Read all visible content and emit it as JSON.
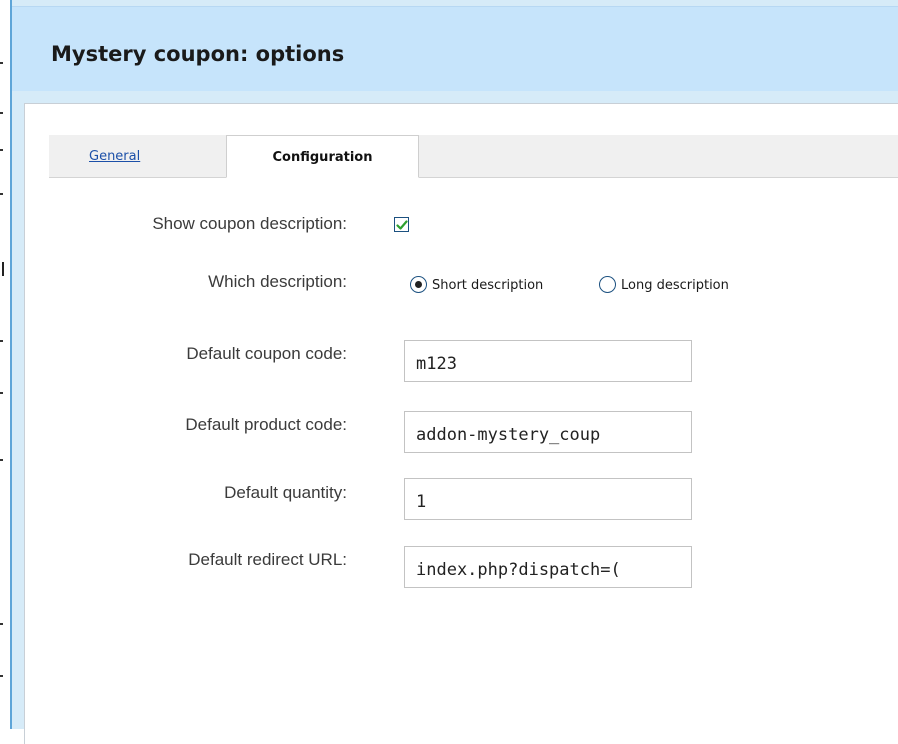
{
  "dialog": {
    "title": "Mystery coupon: options"
  },
  "tabs": [
    {
      "label": "General",
      "active": false
    },
    {
      "label": "Configuration",
      "active": true
    }
  ],
  "form": {
    "show_description": {
      "label": "Show coupon description:",
      "checked": true
    },
    "which_description": {
      "label": "Which description:",
      "options": [
        {
          "label": "Short description",
          "selected": true
        },
        {
          "label": "Long description",
          "selected": false
        }
      ]
    },
    "coupon_code": {
      "label": "Default coupon code:",
      "value": "m123"
    },
    "product_code": {
      "label": "Default product code:",
      "value": "addon-mystery_coup"
    },
    "quantity": {
      "label": "Default quantity:",
      "value": "1"
    },
    "redirect_url": {
      "label": "Default redirect URL:",
      "value": "index.php?dispatch=("
    }
  },
  "colors": {
    "header_bg": "#c6e4fb",
    "frame_bg": "#d6ebf8",
    "link": "#1c50a8",
    "check": "#2ea02e"
  },
  "icons": {
    "checkbox_mark": "check-icon"
  }
}
